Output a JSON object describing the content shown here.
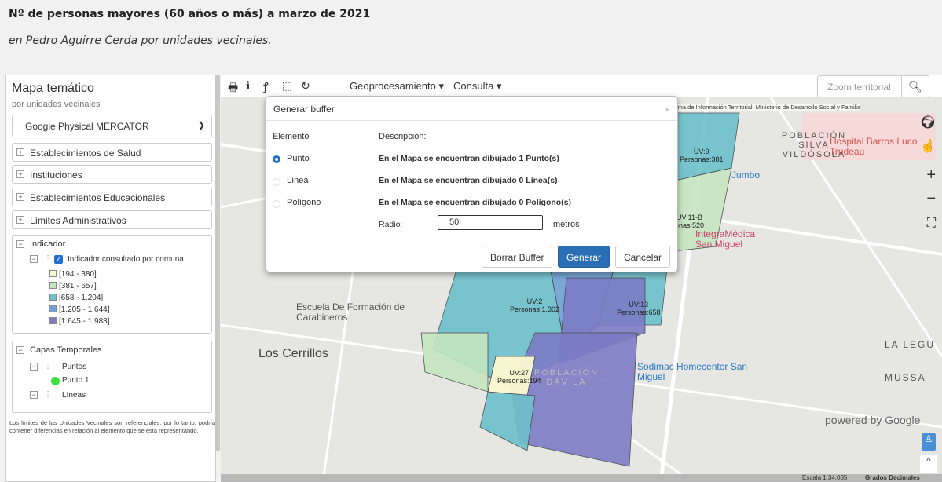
{
  "header": {
    "title": "Nº de personas mayores (60 años o más) a marzo de 2021",
    "subtitle": "en Pedro Aguirre Cerda por unidades vecinales."
  },
  "panel": {
    "title": "Mapa temático",
    "subtitle": "por unidades vecinales",
    "basemap_select": "Google Physical MERCATOR",
    "groups": [
      "Establecimientos de Salud",
      "Instituciones",
      "Establecimientos Educacionales",
      "Límites Administrativos"
    ],
    "indicator": {
      "label": "Indicador",
      "checkbox_label": "Indicador consultado por comuna",
      "legend": [
        {
          "range": "[194 - 380]",
          "color": "#fcf8d0"
        },
        {
          "range": "[381 - 657]",
          "color": "#c5e6c0"
        },
        {
          "range": "[658 - 1.204]",
          "color": "#6dc1cc"
        },
        {
          "range": "[1.205 - 1.644]",
          "color": "#6fa2d6"
        },
        {
          "range": "[1.645 - 1.983]",
          "color": "#7c7cc6"
        }
      ]
    },
    "temp_layers": {
      "label": "Capas Temporales",
      "puntos": "Puntos",
      "punto1": "Punto 1",
      "lineas": "Líneas"
    },
    "note": "Los límites de las Unidades Vecinales son referenciales, por lo tanto, podría contener diferencias en relación al elemento que se está representando."
  },
  "toolbar": {
    "menu_geoproc": "Geoprocesamiento ▾",
    "menu_consulta": "Consulta ▾",
    "zoom_placeholder": "Zoom territorial"
  },
  "map": {
    "attribution": "Sistema de Información Territorial, Ministerio de Desarrollo Social y Familia",
    "labels": {
      "los_cerrillos": "Los Cerrillos",
      "escuela": "Escuela De Formación de Carabineros",
      "hospital": "Hospital Barros Luco Trudeau",
      "integramedica": "IntegraMédica San Miguel",
      "jumbo": "Jumbo",
      "sodimac": "Sodimac Homecenter San Miguel",
      "poblacion_silva": "POBLACIÓN SILVA VILDÓSOLA",
      "poblacion_davila": "POBLACIÓN DÁVILA",
      "mussa": "MUSSA",
      "la_legua": "LA LEGU",
      "powered": "powered by Google",
      "scale": "Escala 1:34.085",
      "coords": "Grados Decimales"
    },
    "uv": [
      {
        "name": "UV:9",
        "persons": "Personas:381"
      },
      {
        "name": "UV:11-B",
        "persons": "onas:520"
      },
      {
        "name": "UV:2",
        "persons": "Personas:1.302"
      },
      {
        "name": "UV:13",
        "persons": "Personas:658"
      },
      {
        "name": "UV:27",
        "persons": "Personas:194"
      }
    ]
  },
  "modal": {
    "title": "Generar buffer",
    "col_element": "Elemento",
    "col_desc": "Descripción:",
    "options": [
      {
        "label": "Punto",
        "desc": "En el Mapa se encuentran dibujado 1 Punto(s)",
        "selected": true
      },
      {
        "label": "Línea",
        "desc": "En el Mapa se encuentran dibujado 0 Línea(s)",
        "selected": false
      },
      {
        "label": "Polígono",
        "desc": "En el Mapa se encuentran dibujado 0 Polígono(s)",
        "selected": false
      }
    ],
    "radius_label": "Radio:",
    "radius_value": "50",
    "radius_unit": "metros",
    "btn_clear": "Borrar Buffer",
    "btn_generate": "Generar",
    "btn_cancel": "Cancelar"
  }
}
